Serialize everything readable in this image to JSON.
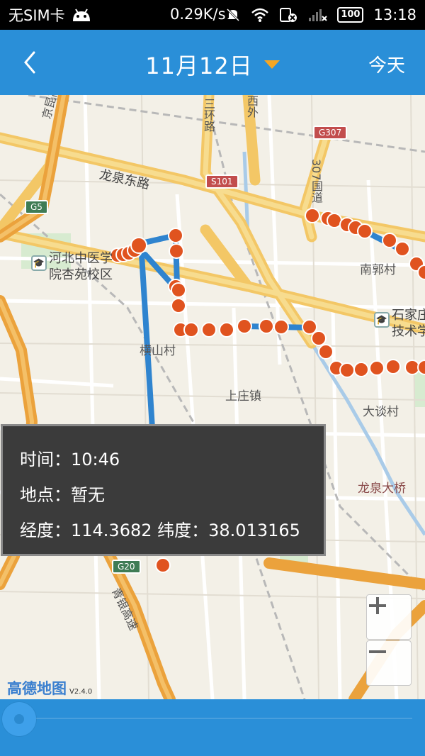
{
  "status_bar": {
    "carrier": "无SIM卡",
    "speed": "0.29K/s",
    "battery": "100",
    "time": "13:18"
  },
  "header": {
    "back_icon": "chevron-left-icon",
    "date": "11月12日",
    "dropdown_icon": "triangle-down-icon",
    "today_label": "今天",
    "background": "#2a8fd8",
    "accent": "#f5a623"
  },
  "map": {
    "roads": {
      "jingkun": "京昆高速",
      "longquan_east": "龙泉东路",
      "sanhuan": "三环路",
      "xiwai": "西外",
      "g307": "G307",
      "s101": "S101",
      "r307": "307国道",
      "g5": "G5",
      "g20": "G20",
      "qingyin": "青银高速"
    },
    "places": {
      "hebei_tcm_1": "河北中医学",
      "hebei_tcm_2": "院杏苑校区",
      "nanguo": "南郭村",
      "shijiazhuang_1": "石家庄",
      "shijiazhuang_2": "技术学",
      "hengshan": "横山村",
      "shangzhuang": "上庄镇",
      "datan": "大谈村",
      "longquan_bridge": "龙泉大桥"
    },
    "track_color": "#e0531f",
    "line_color": "#2f84cf"
  },
  "info_popup": {
    "time_label": "时间：10:46",
    "place_label": "地点：暂无",
    "coords_label": "经度：114.3682 纬度：38.013165"
  },
  "zoom": {
    "in_icon": "plus-icon",
    "out_icon": "minus-icon"
  },
  "logo": {
    "name": "高德地图",
    "version": "V2.4.0"
  },
  "bottom_bar": {
    "slider_icon": "slider-thumb"
  }
}
